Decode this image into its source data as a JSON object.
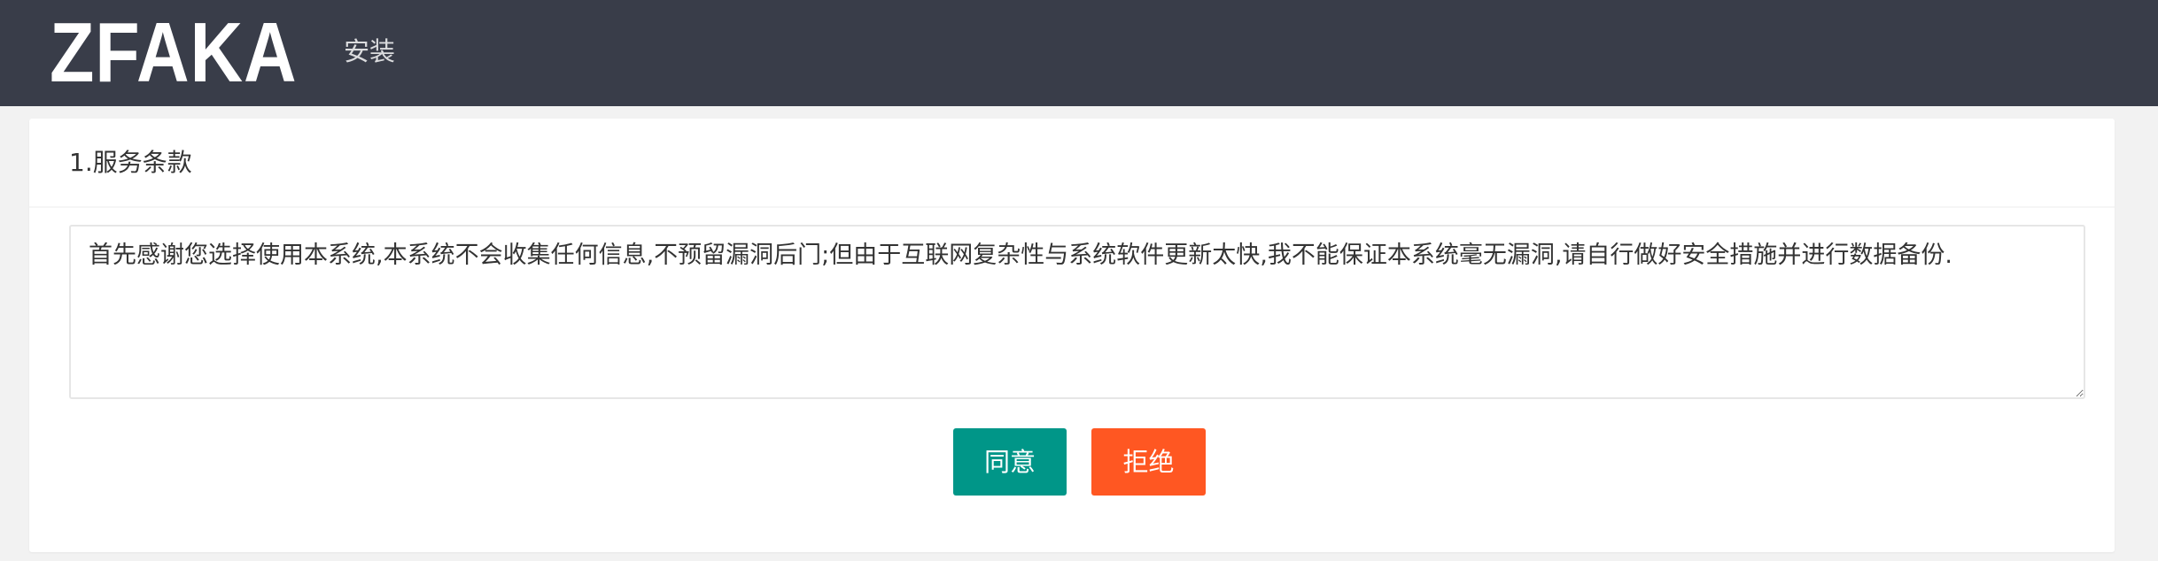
{
  "header": {
    "logo_text": "ZFAKA",
    "nav": [
      {
        "label": "安装"
      }
    ]
  },
  "card": {
    "title": "1.服务条款",
    "terms_text": "首先感谢您选择使用本系统,本系统不会收集任何信息,不预留漏洞后门;但由于互联网复杂性与系统软件更新太快,我不能保证本系统毫无漏洞,请自行做好安全措施并进行数据备份.",
    "buttons": {
      "agree_label": "同意",
      "reject_label": "拒绝"
    }
  },
  "colors": {
    "header_bg": "#393d49",
    "agree": "#009688",
    "reject": "#ff5722",
    "page_bg": "#f2f2f2"
  }
}
